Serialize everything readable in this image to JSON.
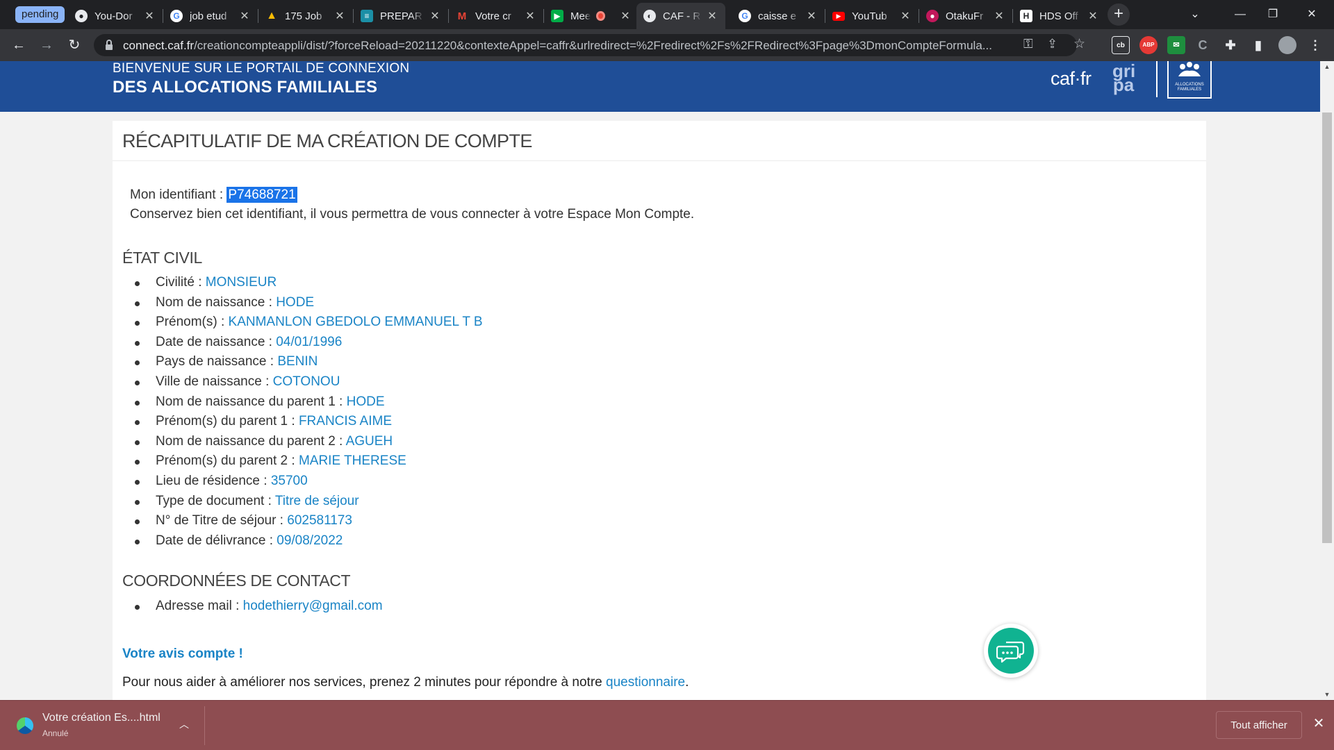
{
  "browser": {
    "group_label": "pending",
    "tabs": [
      {
        "title": "You-Dor",
        "icon": "github-icon"
      },
      {
        "title": "job etud",
        "icon": "google-icon"
      },
      {
        "title": "175 Job",
        "icon": "drive-icon"
      },
      {
        "title": "PREPAR",
        "icon": "site-icon"
      },
      {
        "title": "Votre cr",
        "icon": "gmail-icon"
      },
      {
        "title": "Mee",
        "icon": "meet-icon"
      },
      {
        "title": "CAF - R",
        "icon": "globe-icon"
      },
      {
        "title": "caisse e",
        "icon": "google-icon"
      },
      {
        "title": "YouTub",
        "icon": "youtube-icon"
      },
      {
        "title": "OtakuFr",
        "icon": "site-icon"
      },
      {
        "title": "HDS Off",
        "icon": "site-icon"
      }
    ],
    "url_host": "connect.caf.fr",
    "url_path": "/creationcompteappli/dist/?forceReload=20211220&contexteAppel=caffr&urlredirect=%2Fredirect%2Fs%2FRedirect%3Fpage%3DmonCompteFormula..."
  },
  "header": {
    "welcome_line1": "BIENVENUE SUR LE PORTAIL DE CONNEXION",
    "welcome_line2": "DES ALLOCATIONS FAMILIALES",
    "logo_caf": "caf·fr",
    "logo_gripa_top": "gri",
    "logo_gripa_bottom": "pa",
    "emblem_text": "ALLOCATIONS FAMILIALES"
  },
  "summary": {
    "title": "RÉCAPITULATIF DE MA CRÉATION DE COMPTE",
    "id_label": "Mon identifiant : ",
    "id_value": "P74688721",
    "id_note": "Conservez bien cet identifiant, il vous permettra de vous connecter à votre Espace Mon Compte."
  },
  "etat_civil": {
    "title": "ÉTAT CIVIL",
    "fields": [
      {
        "label": "Civilité : ",
        "value": "MONSIEUR"
      },
      {
        "label": "Nom de naissance : ",
        "value": "HODE"
      },
      {
        "label": "Prénom(s) : ",
        "value": "KANMANLON GBEDOLO EMMANUEL T B"
      },
      {
        "label": "Date de naissance : ",
        "value": "04/01/1996"
      },
      {
        "label": "Pays de naissance : ",
        "value": "BENIN"
      },
      {
        "label": "Ville de naissance : ",
        "value": "COTONOU"
      },
      {
        "label": "Nom de naissance du parent 1 : ",
        "value": "HODE"
      },
      {
        "label": "Prénom(s) du parent 1 : ",
        "value": "FRANCIS AIME"
      },
      {
        "label": "Nom de naissance du parent 2 : ",
        "value": "AGUEH"
      },
      {
        "label": "Prénom(s) du parent 2 : ",
        "value": "MARIE THERESE"
      },
      {
        "label": "Lieu de résidence : ",
        "value": "35700"
      },
      {
        "label": "Type de document : ",
        "value": "Titre de séjour"
      },
      {
        "label": "N° de Titre de séjour : ",
        "value": "602581173"
      },
      {
        "label": "Date de délivrance : ",
        "value": "09/08/2022"
      }
    ]
  },
  "contact": {
    "title": "COORDONNÉES DE CONTACT",
    "fields": [
      {
        "label": "Adresse mail : ",
        "value": "hodethierry@gmail.com"
      }
    ]
  },
  "feedback": {
    "title": "Votre avis compte !",
    "text": "Pour nous aider à améliorer nos services, prenez 2 minutes pour répondre à notre ",
    "link": "questionnaire",
    "end": "."
  },
  "downloads": {
    "file_name": "Votre création Es....html",
    "status": "Annulé",
    "show_all": "Tout afficher"
  },
  "colors": {
    "header_blue": "#1f4e97",
    "value_blue": "#1a84c6",
    "chat_green": "#10b391",
    "download_bar": "#8e4d51"
  }
}
